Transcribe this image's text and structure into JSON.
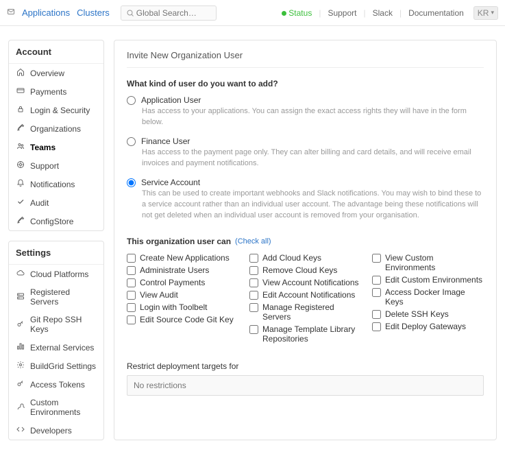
{
  "topnav": {
    "applications": "Applications",
    "clusters": "Clusters",
    "search_placeholder": "Global Search…",
    "status": "Status",
    "support": "Support",
    "slack": "Slack",
    "documentation": "Documentation",
    "avatar_initials": "KR"
  },
  "sidebar": {
    "account": {
      "title": "Account",
      "items": [
        "Overview",
        "Payments",
        "Login & Security",
        "Organizations",
        "Teams",
        "Support",
        "Notifications",
        "Audit",
        "ConfigStore"
      ]
    },
    "settings": {
      "title": "Settings",
      "items": [
        "Cloud Platforms",
        "Registered Servers",
        "Git Repo SSH Keys",
        "External Services",
        "BuildGrid Settings",
        "Access Tokens",
        "Custom Environments",
        "Developers"
      ]
    }
  },
  "main": {
    "title": "Invite New Organization User",
    "question": "What kind of user do you want to add?",
    "opts": [
      {
        "label": "Application User",
        "desc": "Has access to your applications. You can assign the exact access rights they will have in the form below."
      },
      {
        "label": "Finance User",
        "desc": "Has access to the payment page only. They can alter billing and card details, and will receive email invoices and payment notifications."
      },
      {
        "label": "Service Account",
        "desc": "This can be used to create important webhooks and Slack notifications. You may wish to bind these to a service account rather than an individual user account. The advantage being these notifications will not get deleted when an individual user account is removed from your organisation."
      }
    ],
    "perm_head": "This organization user can",
    "check_all": "(Check all)",
    "perms_col1": [
      "Create New Applications",
      "Administrate Users",
      "Control Payments",
      "View Audit",
      "Login with Toolbelt",
      "Edit Source Code Git Key"
    ],
    "perms_col2": [
      "Add Cloud Keys",
      "Remove Cloud Keys",
      "View Account Notifications",
      "Edit Account Notifications",
      "Manage Registered Servers",
      "Manage Template Library Repositories"
    ],
    "perms_col3": [
      "View Custom Environments",
      "Edit Custom Environments",
      "Access Docker Image Keys",
      "Delete SSH Keys",
      "Edit Deploy Gateways"
    ],
    "restrict_label": "Restrict deployment targets for",
    "restrict_placeholder": "No restrictions"
  }
}
